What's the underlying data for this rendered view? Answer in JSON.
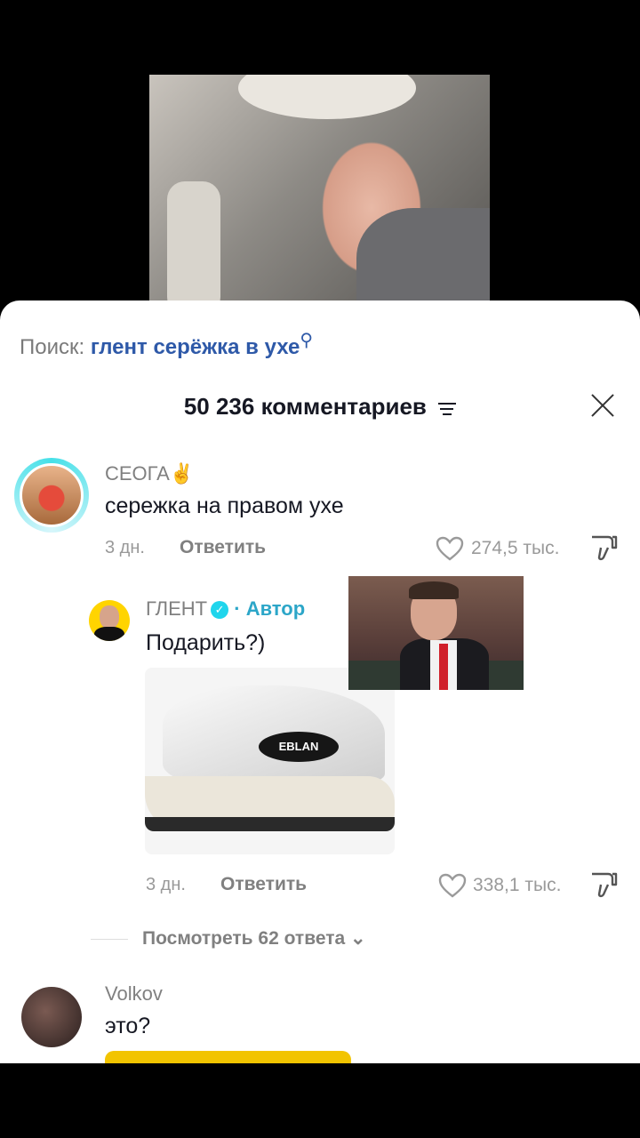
{
  "search": {
    "prefix": "Поиск:",
    "query": "глент серёжка в ухе"
  },
  "comments_header": {
    "count_label": "50 236 комментариев"
  },
  "comments": [
    {
      "username": "СЕОГА✌️",
      "text": "сережка на правом ухе",
      "age": "3 дн.",
      "reply_label": "Ответить",
      "likes": "274,5 тыс."
    }
  ],
  "reply": {
    "username": "ГЛЕНТ",
    "verified_mark": "✓",
    "author_label": "· Автор",
    "text": "Подарить?)",
    "image_label": "EBLAN",
    "age": "3 дн.",
    "reply_label": "Ответить",
    "likes": "338,1 тыс."
  },
  "view_replies": "Посмотреть 62 ответа ⌄",
  "next_comment": {
    "username": "Volkov",
    "text": "это?"
  },
  "colors": {
    "accent_link": "#2e59a8",
    "author": "#2ca6c8",
    "story_ring": "#45e0e8"
  }
}
